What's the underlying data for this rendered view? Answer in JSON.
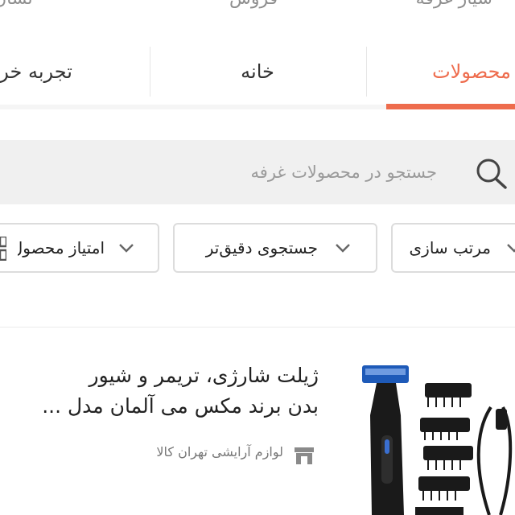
{
  "top_row": {
    "right": "شیار غرفه",
    "center": "فروش",
    "left": "نشان"
  },
  "tabs": [
    {
      "label": "محصولات",
      "active": true
    },
    {
      "label": "خانه",
      "active": false
    },
    {
      "label": "تجربه خرید",
      "active": false
    }
  ],
  "search": {
    "placeholder": "جستجو در محصولات غرفه",
    "value": ""
  },
  "filters": [
    {
      "label": "مرتب سازی"
    },
    {
      "label": "جستجوی دقیق‌تر"
    },
    {
      "label": "امتیاز محصول"
    }
  ],
  "product": {
    "title_line1": "ژیلت شارژی، تریمر و شیور",
    "title_line2": "بدن برند مکس می آلمان مدل ...",
    "seller": "لوازم آرایشی تهران کالا"
  },
  "colors": {
    "accent": "#ee6c4d",
    "search_bg": "#f0f0f0"
  },
  "icons": {
    "search": "search-icon",
    "chevron": "chevron-down-icon",
    "store": "store-icon",
    "grid": "grid-icon"
  }
}
